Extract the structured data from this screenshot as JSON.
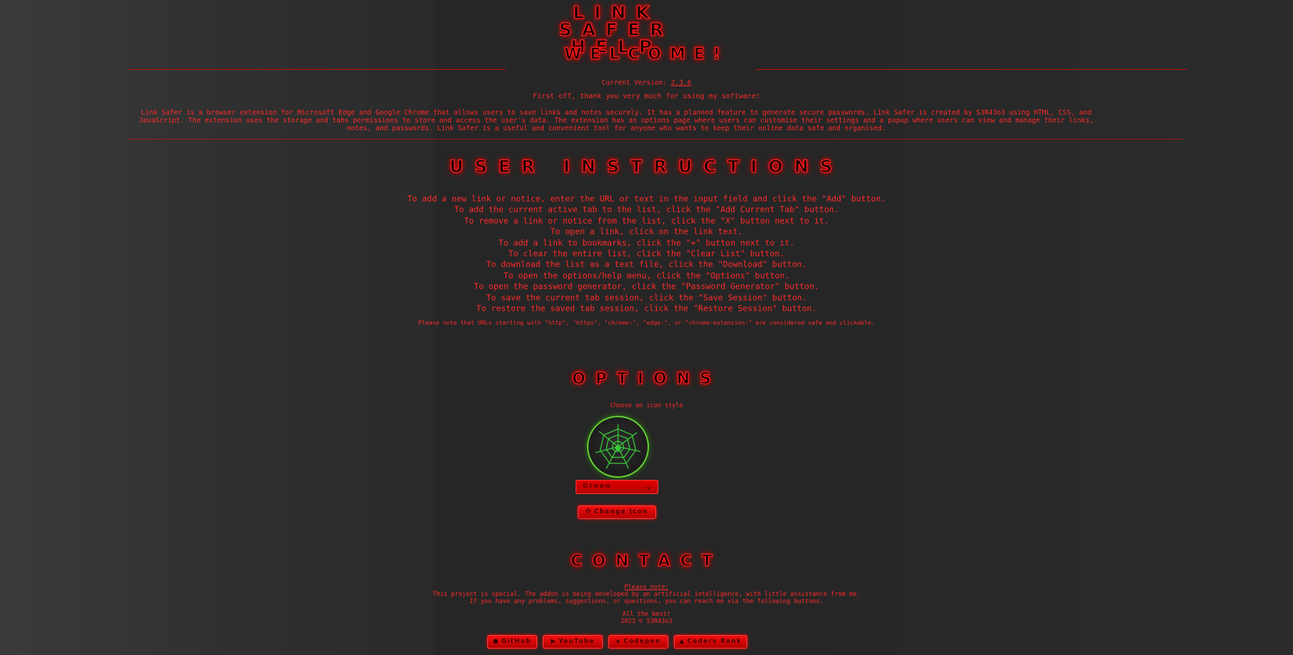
{
  "header": {
    "title": "Link Safer Help",
    "welcome": "Welcome!"
  },
  "version": {
    "label": "Current Version:",
    "value": "2.3.6"
  },
  "intro": {
    "thanks": "First off, thank you very much for using my software!",
    "description": "Link Safer is a browser extension for Microsoft Edge and Google Chrome that allows users to save links and notes securely. It has a planned feature to generate secure passwords. Link Safer is created by S3R43o3 using HTML, CSS, and JavaScript. The extension uses the storage and tabs permissions to store and access the user's data. The extension has an options page where users can customise their settings and a popup where users can view and manage their links, notes, and passwords. Link Safer is a useful and convenient tool for anyone who wants to keep their online data safe and organised."
  },
  "instructions": {
    "heading": "User Instructions",
    "items": [
      "To add a new link or notice, enter the URL or text in the input field and click the \"Add\" button.",
      "To add the current active tab to the list, click the \"Add Current Tab\" button.",
      "To remove a link or notice from the list, click the \"X\" button next to it.",
      "To open a link, click on the link text.",
      "To add a link to bookmarks, click the \"+\" button next to it.",
      "To clear the entire list, click the \"Clear List\" button.",
      "To download the list as a text file, click the \"Download\" button.",
      "To open the options/help menu, click the \"Options\" button.",
      "To open the password generator, click the \"Password Generator\" button.",
      "To save the current tab session, click the \"Save Session\" button.",
      "To restore the saved tab session, click the \"Restore Session\" button."
    ],
    "note": "Please note that URLs starting with \"http\", \"https\", \"chrome:\", \"edge:\", or \"chrome-extension:\" are considered safe and clickable."
  },
  "options": {
    "heading": "Options",
    "choose_label": "Choose an icon style",
    "icon_name": "spider-web-icon",
    "icon_color": "#39c639",
    "select_value": "Green",
    "change_button": "Change Icon"
  },
  "contact": {
    "heading": "Contact",
    "note_title": "Please note:",
    "line1": "This project is special. The addon is being developed by an artificial intelligence, with little assistance from me.",
    "line2": "If you have any problems, suggestions, or questions, you can reach me via the following buttons.",
    "best": "All the best!",
    "copyright": "2023 © S3R43o3",
    "buttons": [
      "GitHub",
      "YouTube",
      "Codepen",
      "Coders Rank"
    ]
  },
  "colors": {
    "accent": "#ff1a1a",
    "background": "#262626",
    "icon_green": "#66d035"
  }
}
